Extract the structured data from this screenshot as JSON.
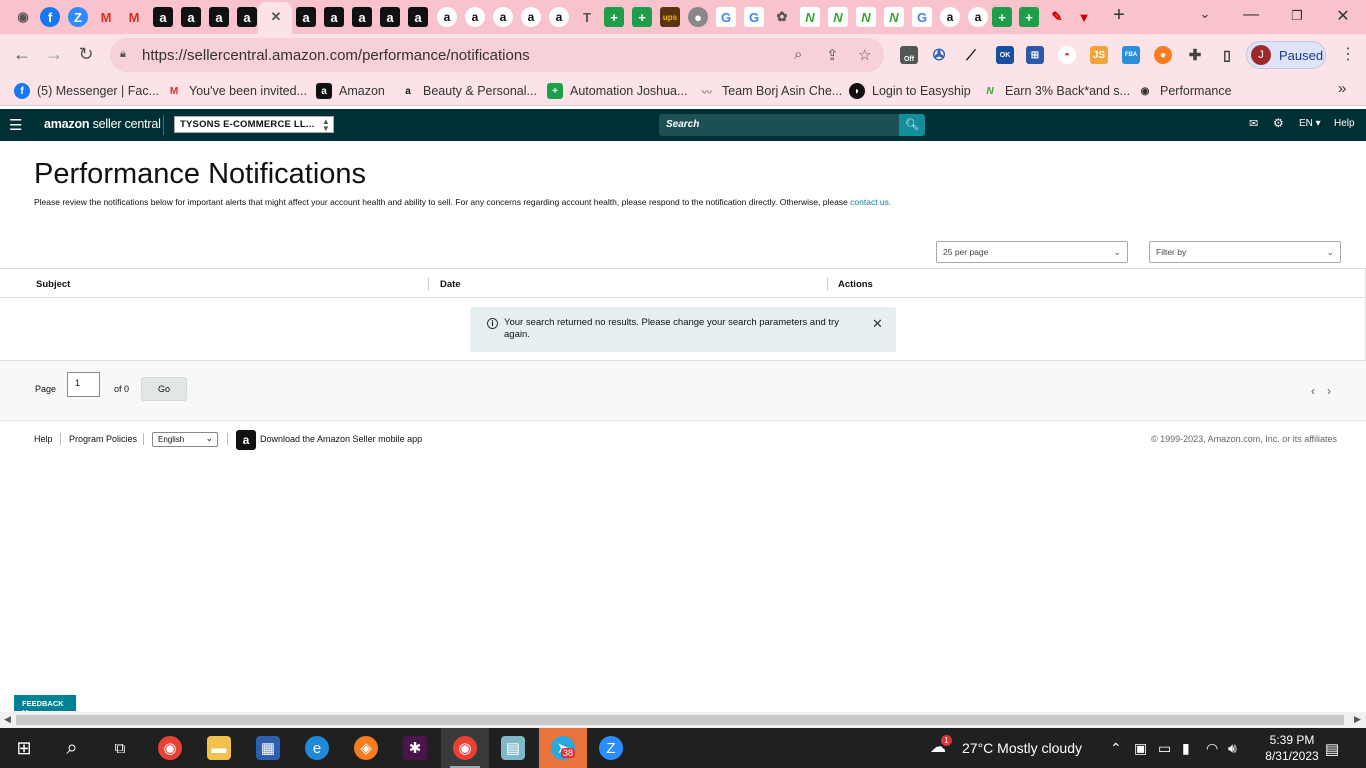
{
  "browser": {
    "tabs": [
      {
        "icon": "chrome-icon",
        "glyph": "◉",
        "style": "ch"
      },
      {
        "icon": "facebook-icon",
        "glyph": "f",
        "style": "msg"
      },
      {
        "icon": "zoom-icon",
        "glyph": "Z",
        "style": "zoom"
      },
      {
        "icon": "gmail-icon",
        "glyph": "M",
        "style": "gm"
      },
      {
        "icon": "gmail-icon",
        "glyph": "M",
        "style": "gm"
      },
      {
        "icon": "amazon-icon",
        "glyph": "a",
        "style": "amz"
      },
      {
        "icon": "amazon-icon",
        "glyph": "a",
        "style": "amz"
      },
      {
        "icon": "amazon-icon",
        "glyph": "a",
        "style": "amz"
      },
      {
        "icon": "amazon-icon",
        "glyph": "a",
        "style": "amz"
      },
      {
        "icon": "close-tab-icon",
        "glyph": "✕",
        "style": "ch"
      },
      {
        "icon": "amazon-icon",
        "glyph": "a",
        "style": "amz"
      },
      {
        "icon": "amazon-icon",
        "glyph": "a",
        "style": "amz"
      },
      {
        "icon": "amazon-icon",
        "glyph": "a",
        "style": "amz"
      },
      {
        "icon": "amazon-icon",
        "glyph": "a",
        "style": "amz"
      },
      {
        "icon": "amazon-icon",
        "glyph": "a",
        "style": "amz"
      },
      {
        "icon": "amazon-smile-icon",
        "glyph": "a",
        "style": "amzw"
      },
      {
        "icon": "amazon-smile-icon",
        "glyph": "a",
        "style": "amzw"
      },
      {
        "icon": "amazon-smile-icon",
        "glyph": "a",
        "style": "amzw"
      },
      {
        "icon": "amazon-smile-icon",
        "glyph": "a",
        "style": "amzw"
      },
      {
        "icon": "amazon-smile-icon",
        "glyph": "a",
        "style": "amzw"
      },
      {
        "icon": "script-icon",
        "glyph": "T",
        "style": "ch"
      },
      {
        "icon": "sheets-icon",
        "glyph": "+",
        "style": "green"
      },
      {
        "icon": "sheets-icon",
        "glyph": "+",
        "style": "green"
      },
      {
        "icon": "ups-icon",
        "glyph": "ups",
        "style": "ups"
      },
      {
        "icon": "globe-icon",
        "glyph": "●",
        "style": "grey"
      },
      {
        "icon": "google-icon",
        "glyph": "G",
        "style": "gg"
      },
      {
        "icon": "google-icon",
        "glyph": "G",
        "style": "gg"
      },
      {
        "icon": "plant-icon",
        "glyph": "✿",
        "style": "ch"
      },
      {
        "icon": "n-icon",
        "glyph": "N",
        "style": "grn2"
      },
      {
        "icon": "n-icon",
        "glyph": "N",
        "style": "grn2"
      },
      {
        "icon": "n-icon",
        "glyph": "N",
        "style": "grn2"
      },
      {
        "icon": "n-icon",
        "glyph": "N",
        "style": "grn2"
      },
      {
        "icon": "google-icon",
        "glyph": "G",
        "style": "gg"
      },
      {
        "icon": "amazon-smile-icon",
        "glyph": "a",
        "style": "amzw"
      },
      {
        "icon": "amazon-smile-icon",
        "glyph": "a",
        "style": "amzw"
      },
      {
        "icon": "sheets-icon",
        "glyph": "+",
        "style": "green"
      },
      {
        "icon": "sheets-icon",
        "glyph": "+",
        "style": "green"
      },
      {
        "icon": "brush-icon",
        "glyph": "✎",
        "style": "red"
      },
      {
        "icon": "shield-icon",
        "glyph": "▼",
        "style": "red"
      }
    ],
    "new_tab_glyph": "+",
    "url": "https://sellercentral.amazon.com/performance/notifications",
    "profile_initial": "J",
    "profile_status": "Paused",
    "bookmarks": [
      {
        "label": "(5) Messenger | Fac...",
        "icon": "facebook-icon",
        "glyph": "f"
      },
      {
        "label": "You've been invited...",
        "icon": "gmail-icon",
        "glyph": "M"
      },
      {
        "label": "Amazon",
        "icon": "amazon-icon",
        "glyph": "a"
      },
      {
        "label": "Beauty & Personal...",
        "icon": "amazon-smile-icon",
        "glyph": "a"
      },
      {
        "label": "Automation Joshua...",
        "icon": "sheets-icon",
        "glyph": "+"
      },
      {
        "label": "Team Borj Asin Che...",
        "icon": "signature-icon",
        "glyph": "〰"
      },
      {
        "label": "Login to Easyship",
        "icon": "easyship-icon",
        "glyph": "◗"
      },
      {
        "label": "Earn 3% Back*and s...",
        "icon": "n-icon",
        "glyph": "N"
      },
      {
        "label": "Performance",
        "icon": "globe-icon",
        "glyph": "◉"
      }
    ],
    "bookmarks_more": "»",
    "ext_badge": "Off",
    "ext_ok": "OK",
    "ext_js": "JS",
    "ext_fba": "FBA"
  },
  "seller_nav": {
    "logo_amazon": "amazon",
    "logo_sc": "seller central",
    "account": "TYSONS E-COMMERCE LL...",
    "search_placeholder": "Search",
    "language": "EN",
    "help": "Help"
  },
  "page": {
    "title": "Performance Notifications",
    "description": "Please review the notifications below for important alerts that might affect your account health and ability to sell. For any concerns regarding account health, please respond to the notification directly. Otherwise, please",
    "contact_link": "contact us.",
    "per_page": "25 per page",
    "filter": "Filter by",
    "columns": [
      "Subject",
      "Date",
      "Actions"
    ],
    "alert": "Your search returned no results. Please change your search parameters and try again.",
    "pager": {
      "label": "Page",
      "value": "1",
      "of": "of 0",
      "go": "Go"
    }
  },
  "footer": {
    "help": "Help",
    "policies": "Program Policies",
    "language": "English",
    "app": "Download the Amazon Seller mobile app",
    "copyright": "© 1999-2023, Amazon.com, Inc. or its affiliates",
    "feedback": "FEEDBACK"
  },
  "taskbar": {
    "temperature": "27°C",
    "weather": "Mostly cloudy",
    "time": "5:39 PM",
    "date": "8/31/2023",
    "weather_badge": "1",
    "app_badge": "38"
  },
  "colors": {
    "nav": "#002f36",
    "accent": "#008296",
    "tabbar": "#f9c3cd"
  }
}
